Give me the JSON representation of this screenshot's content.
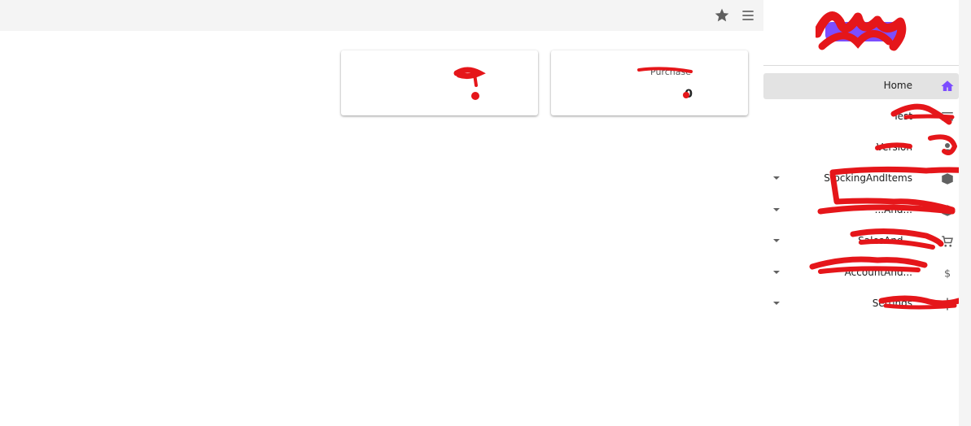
{
  "topbar": {
    "icons": [
      "star-icon",
      "menu-icon"
    ]
  },
  "cards": [
    {
      "title": "",
      "value": ""
    },
    {
      "title": "Purchase",
      "value": "0"
    }
  ],
  "sidebar": {
    "items": [
      {
        "label": "Home",
        "icon": "home-icon",
        "active": true,
        "expandable": false
      },
      {
        "label": "Test",
        "icon": "table-icon",
        "active": false,
        "expandable": false
      },
      {
        "label": "Version",
        "icon": "person-icon",
        "active": false,
        "expandable": false
      },
      {
        "label": "StockingAndItems",
        "icon": "box-icon",
        "active": false,
        "expandable": true
      },
      {
        "label": "...And...",
        "icon": "box-icon",
        "active": false,
        "expandable": true
      },
      {
        "label": "SalesAnd...",
        "icon": "cart-icon",
        "active": false,
        "expandable": true
      },
      {
        "label": "AccountAnd...",
        "icon": "dollar-icon",
        "active": false,
        "expandable": true
      },
      {
        "label": "Settings",
        "icon": "gear-icon",
        "active": false,
        "expandable": true
      }
    ]
  },
  "colors": {
    "accent": "#7c4dff",
    "redaction": "#e5161a",
    "topbar_bg": "#f4f4f4",
    "active_item_bg": "#e3e3e3"
  }
}
